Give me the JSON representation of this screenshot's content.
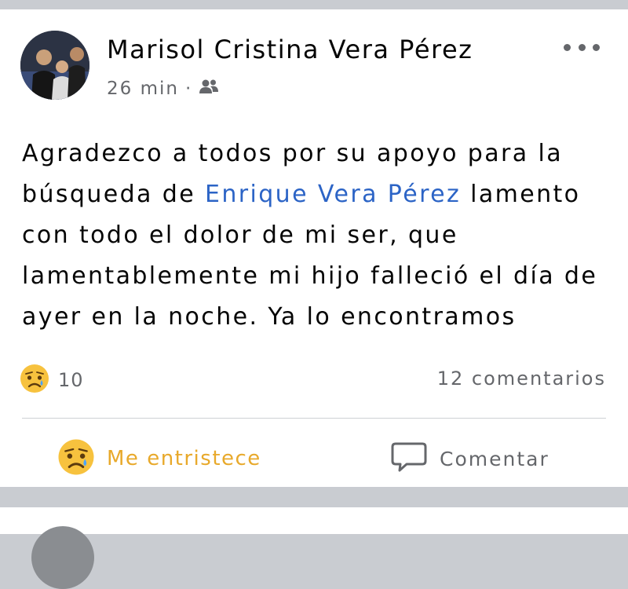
{
  "post": {
    "author": "Marisol Cristina Vera Pérez",
    "time": "26 min",
    "separator": "·",
    "audience_icon": "friends-icon",
    "more_icon": "more-options-icon",
    "text": {
      "before_mention": "Agradezco a todos por su apoyo para la búsqueda de ",
      "mention": "Enrique Vera Pérez",
      "after_mention": " lamento con todo el dolor de mi ser, que lamentablemente mi hijo falleció el día de ayer en la noche. Ya lo encontramos"
    },
    "reactions": {
      "icon": "sad-reaction-icon",
      "count": "10"
    },
    "comments_count": "12 comentarios"
  },
  "actions": {
    "react": {
      "label": "Me entristece",
      "icon": "sad-reaction-icon",
      "color": "#e8a92b"
    },
    "comment": {
      "label": "Comentar",
      "icon": "comment-icon"
    }
  },
  "colors": {
    "background": "#c9ccd1",
    "card": "#ffffff",
    "mention": "#2c64c6",
    "secondary_text": "#65676b"
  }
}
